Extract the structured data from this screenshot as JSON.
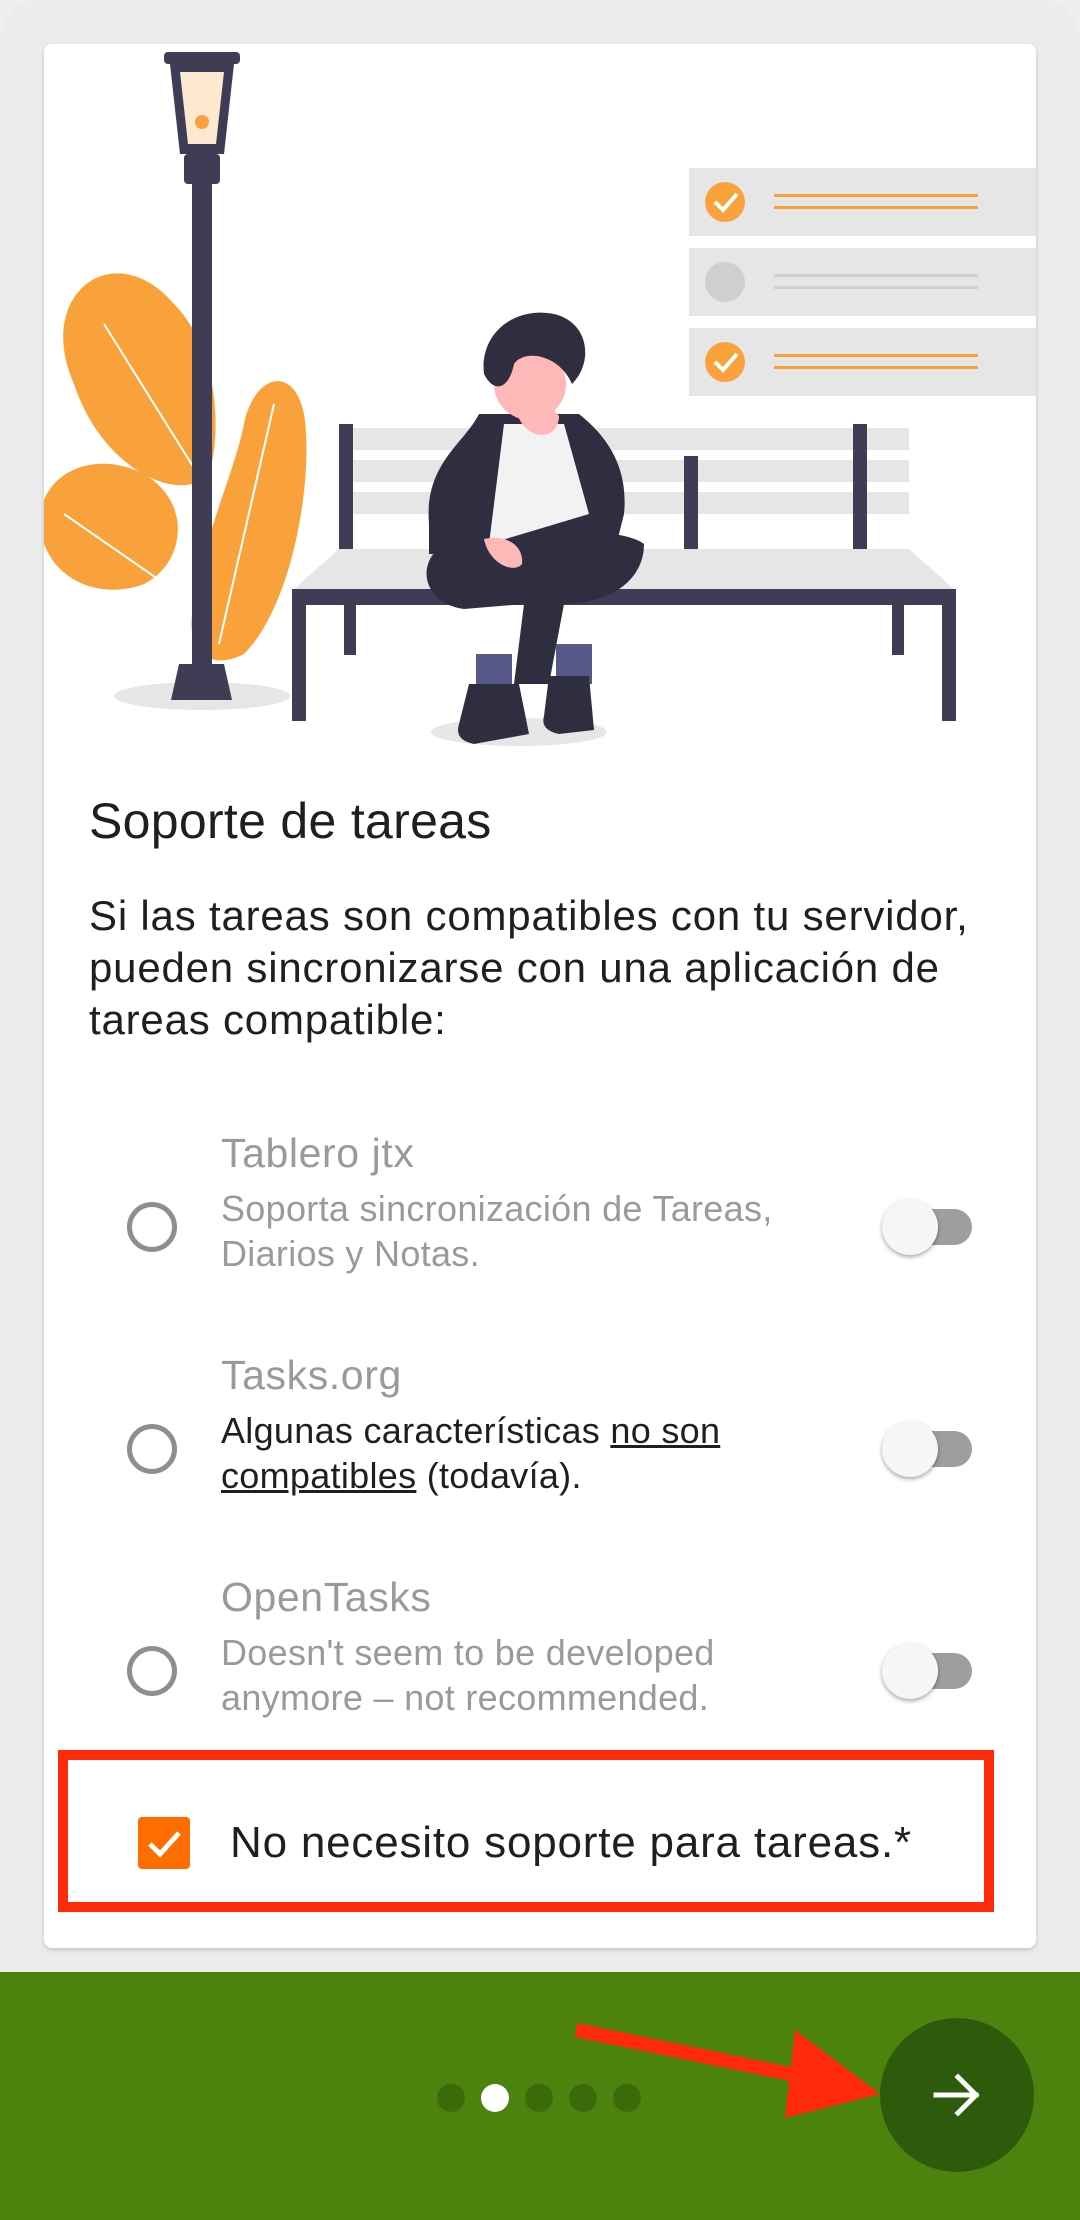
{
  "screen": {
    "title": "Soporte de tareas",
    "description": "Si las tareas son compatibles con tu servidor, pueden sincronizarse con una aplicación de tareas compatible:"
  },
  "options": [
    {
      "name": "Tablero jtx",
      "description": "Soporta sincronización de Tareas, Diarios y Notas.",
      "selected": false,
      "installed": false
    },
    {
      "name": "Tasks.org",
      "description_prefix": "Algunas características ",
      "description_link": "no son compatibles",
      "description_suffix": " (todavía).",
      "selected": false,
      "installed": false
    },
    {
      "name": "OpenTasks",
      "description": "Doesn't seem to be developed anymore – not recommended.",
      "selected": false,
      "installed": false
    }
  ],
  "no_support": {
    "label": "No necesito soporte para tareas.*",
    "checked": true
  },
  "pager": {
    "total_pages": 5,
    "current_page": 2
  },
  "icons": {
    "next": "arrow-right-icon",
    "check": "check-icon"
  },
  "colors": {
    "accent": "#ff6d00",
    "bottom_bar": "#4c830f",
    "next_button": "#2e5a0c",
    "annotation": "#ff2a0a"
  }
}
